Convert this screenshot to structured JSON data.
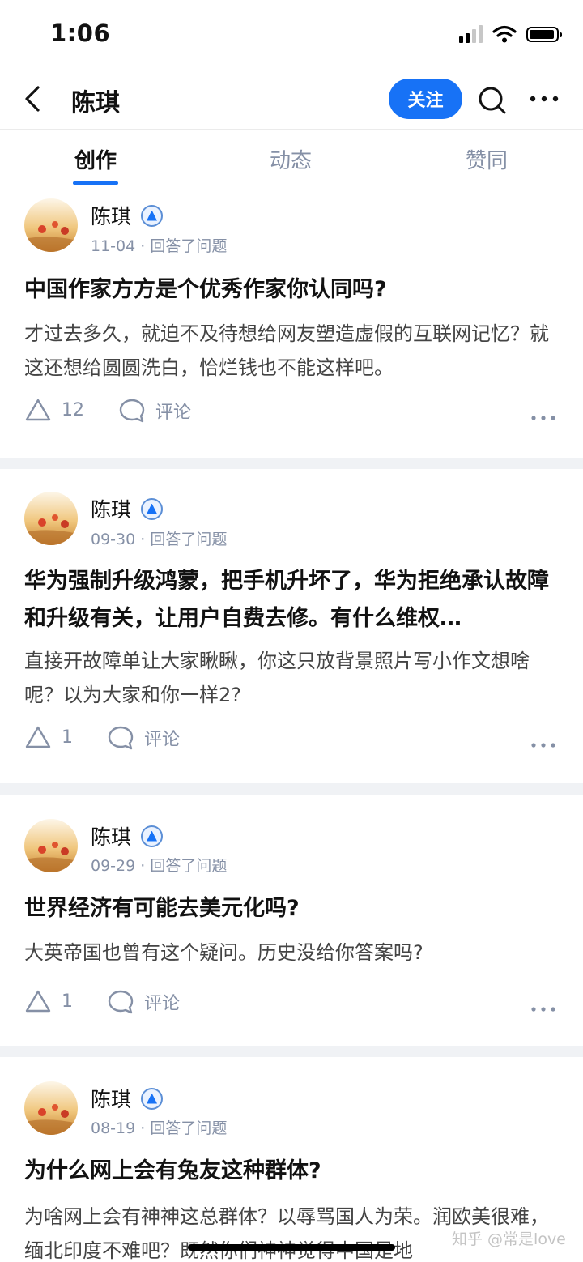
{
  "status": {
    "time": "1:06"
  },
  "nav": {
    "title": "陈琪",
    "follow_label": "关注"
  },
  "tabs": [
    {
      "label": "创作",
      "active": true
    },
    {
      "label": "动态",
      "active": false
    },
    {
      "label": "赞同",
      "active": false
    }
  ],
  "feed": [
    {
      "author": "陈琪",
      "meta": "11-04 · 回答了问题",
      "title": "中国作家方方是个优秀作家你认同吗?",
      "excerpt": "才过去多久，就迫不及待想给网友塑造虚假的互联网记忆？就这还想给圆圆洗白，恰烂钱也不能这样吧。",
      "upvotes": "12",
      "comment_label": "评论"
    },
    {
      "author": "陈琪",
      "meta": "09-30 · 回答了问题",
      "title": "华为强制升级鸿蒙，把手机升坏了，华为拒绝承认故障和升级有关，让用户自费去修。有什么维权…",
      "excerpt": "直接开故障单让大家瞅瞅，你这只放背景照片写小作文想啥呢？以为大家和你一样2?",
      "upvotes": "1",
      "comment_label": "评论"
    },
    {
      "author": "陈琪",
      "meta": "09-29 · 回答了问题",
      "title": "世界经济有可能去美元化吗?",
      "excerpt": "大英帝国也曾有这个疑问。历史没给你答案吗?",
      "upvotes": "1",
      "comment_label": "评论"
    },
    {
      "author": "陈琪",
      "meta": "08-19 · 回答了问题",
      "title": "为什么网上会有兔友这种群体?",
      "excerpt": "为啥网上会有神神这总群体？以辱骂国人为荣。润欧美很难，缅北印度不难吧？既然你们神神觉得中国是地",
      "upvotes": "",
      "comment_label": ""
    }
  ],
  "watermark": "知乎 @常是love",
  "colors": {
    "accent": "#1772f6",
    "muted": "#8590a6",
    "separator": "#f0f2f5"
  },
  "icons": [
    "back-arrow-icon",
    "search-icon",
    "more-icon",
    "verified-badge-icon",
    "upvote-icon",
    "comment-icon"
  ]
}
